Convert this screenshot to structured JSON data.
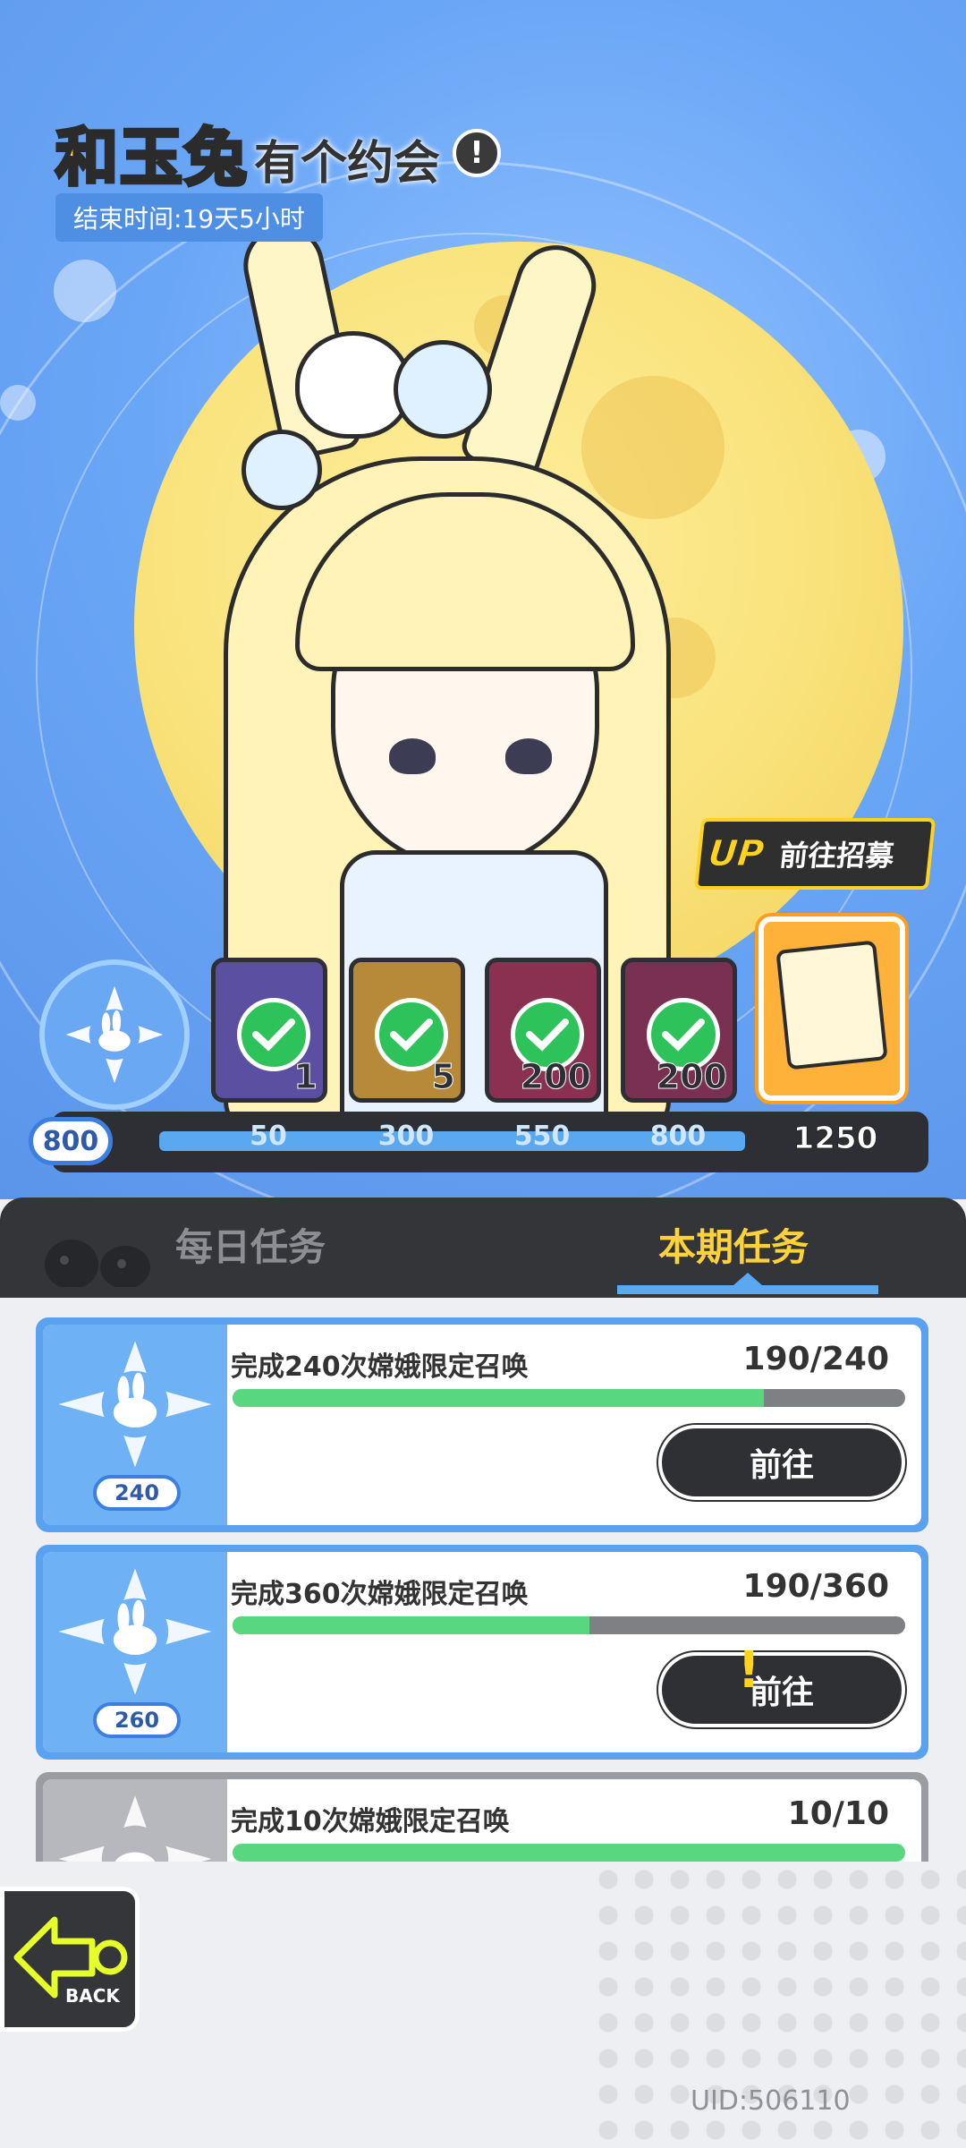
{
  "event": {
    "title_highlight": "和玉兔",
    "title_rest": "有个约会",
    "info_icon": "!",
    "end_time": "结束时间:19天5小时"
  },
  "recruit": {
    "up_tag": "UP",
    "label": "前往招募"
  },
  "reward_track": {
    "current_points": "800",
    "progress": 0.78,
    "milestones": [
      "50",
      "300",
      "550",
      "800",
      "1250"
    ],
    "rewards": [
      {
        "qty": "1",
        "claimed": true,
        "color": "#5a4fa0"
      },
      {
        "qty": "5",
        "claimed": true,
        "color": "#b78a3a"
      },
      {
        "qty": "200",
        "claimed": true,
        "color": "#8a3050"
      },
      {
        "qty": "200",
        "claimed": true,
        "color": "#7a3050"
      }
    ],
    "final_reward_icon": "character-portrait-icon"
  },
  "tabs": {
    "daily": "每日任务",
    "period": "本期任务",
    "active": "period"
  },
  "tasks": [
    {
      "title": "完成240次嫦娥限定召唤",
      "progress_text": "190/240",
      "progress": 0.79,
      "points": "240",
      "button": "前往"
    },
    {
      "title": "完成360次嫦娥限定召唤",
      "progress_text": "190/360",
      "progress": 0.53,
      "points": "260",
      "button": "前往"
    },
    {
      "title": "完成10次嫦娥限定召唤",
      "progress_text": "10/10",
      "progress": 1.0,
      "points": "",
      "button": ""
    }
  ],
  "footer": {
    "back_label": "BACK",
    "uid": "UID:506110"
  },
  "colors": {
    "accent_blue": "#5aa2ef",
    "accent_yellow": "#ffd23a",
    "progress_green": "#58d77f",
    "dark": "#2f3034"
  }
}
